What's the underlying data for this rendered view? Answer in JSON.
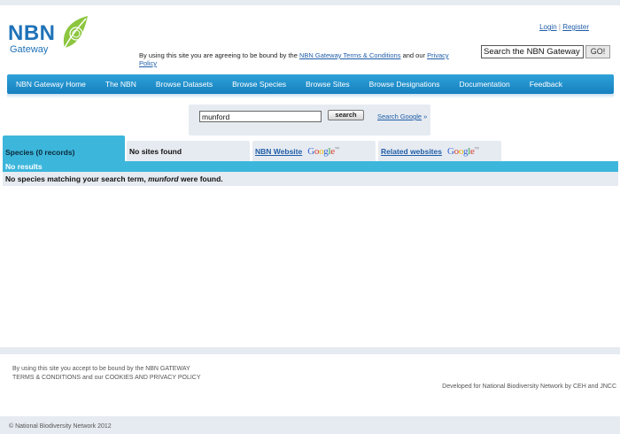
{
  "header": {
    "logo_main": "NBN",
    "logo_sub": "Gateway",
    "login": "Login",
    "separator": "|",
    "register": "Register",
    "agree_prefix": "By using this site you are agreeing to be bound by the",
    "agree_link1": "NBN Gateway Terms & Conditions",
    "agree_mid": "and our",
    "agree_link2": "Privacy Policy",
    "gateway_search_value": "Search the NBN Gateway",
    "go_label": "GO!"
  },
  "nav": {
    "items": [
      "NBN Gateway Home",
      "The NBN",
      "Browse Datasets",
      "Browse Species",
      "Browse Sites",
      "Browse Designations",
      "Documentation",
      "Feedback"
    ]
  },
  "search": {
    "query": "munford",
    "button": "search",
    "google_link": "Search Google",
    "google_arrow": "»"
  },
  "tabs": {
    "species": "Species (0 records)",
    "sites": "No sites found",
    "nbn_website": "NBN Website",
    "related": "Related websites"
  },
  "results": {
    "header": "No results",
    "msg_prefix": "No species matching your search term,",
    "msg_term": "munford",
    "msg_suffix": "were found."
  },
  "footer": {
    "line1": "By using this site you accept to be bound by the NBN GATEWAY",
    "line2": "TERMS & CONDITIONS and our COOKIES AND PRIVACY POLICY",
    "developed": "Developed for National Biodiversity Network by CEH and JNCC",
    "copyright": "© National Biodiversity Network 2012"
  },
  "colors": {
    "brand_blue": "#1f72b8",
    "nav_blue": "#1f8fcc",
    "tab_active": "#3db6dc",
    "logo_green": "#8cc63f"
  }
}
